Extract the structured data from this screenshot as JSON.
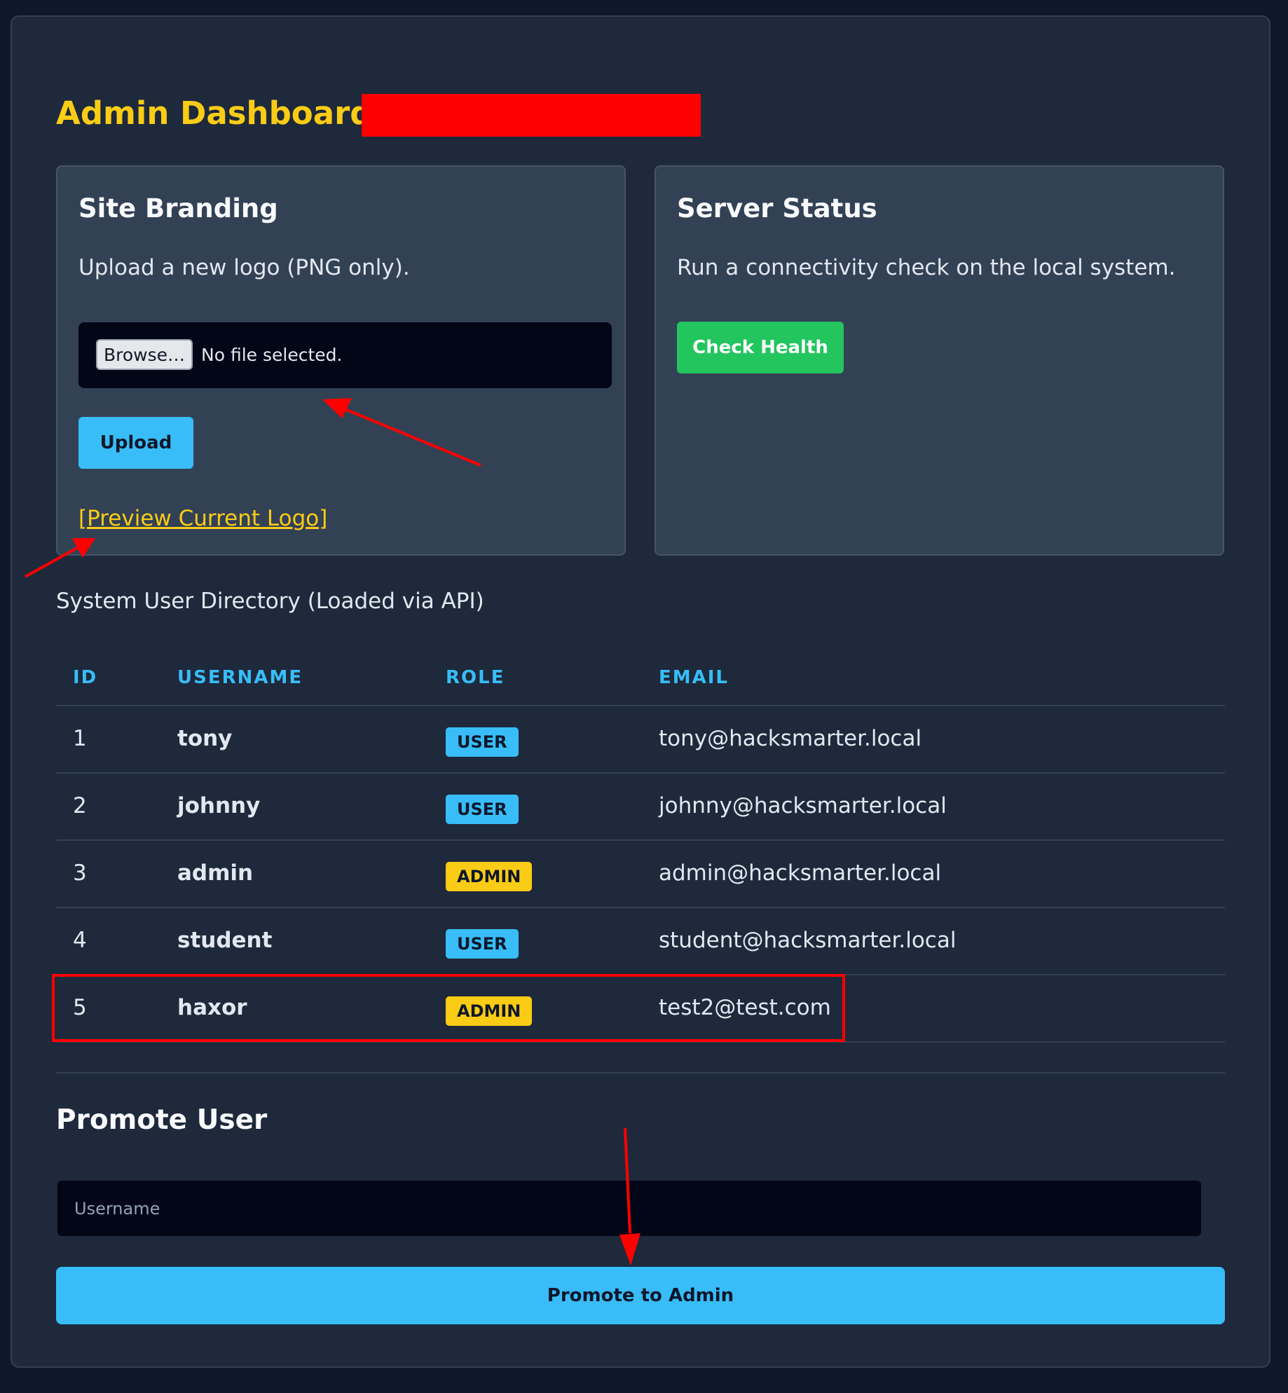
{
  "page": {
    "title": "Admin Dashboard"
  },
  "branding": {
    "heading": "Site Branding",
    "description": "Upload a new logo (PNG only).",
    "browse_label": "Browse…",
    "file_status": "No file selected.",
    "upload_label": "Upload",
    "preview_label": "[Preview Current Logo]"
  },
  "server": {
    "heading": "Server Status",
    "description": "Run a connectivity check on the local system.",
    "check_label": "Check Health"
  },
  "directory": {
    "caption": "System User Directory (Loaded via API)",
    "columns": [
      "ID",
      "USERNAME",
      "ROLE",
      "EMAIL"
    ],
    "rows": [
      {
        "id": "1",
        "username": "tony",
        "role": "USER",
        "email": "tony@hacksmarter.local"
      },
      {
        "id": "2",
        "username": "johnny",
        "role": "USER",
        "email": "johnny@hacksmarter.local"
      },
      {
        "id": "3",
        "username": "admin",
        "role": "ADMIN",
        "email": "admin@hacksmarter.local"
      },
      {
        "id": "4",
        "username": "student",
        "role": "USER",
        "email": "student@hacksmarter.local"
      },
      {
        "id": "5",
        "username": "haxor",
        "role": "ADMIN",
        "email": "test2@test.com"
      }
    ]
  },
  "promote": {
    "heading": "Promote User",
    "input_placeholder": "Username",
    "input_value": "",
    "button_label": "Promote to Admin"
  },
  "colors": {
    "background": "#0f172a",
    "panel": "#1e293b",
    "card": "#334155",
    "accent_yellow": "#facc15",
    "accent_blue": "#38bdf8",
    "accent_green": "#22c55e",
    "annotation_red": "#ff0000"
  }
}
